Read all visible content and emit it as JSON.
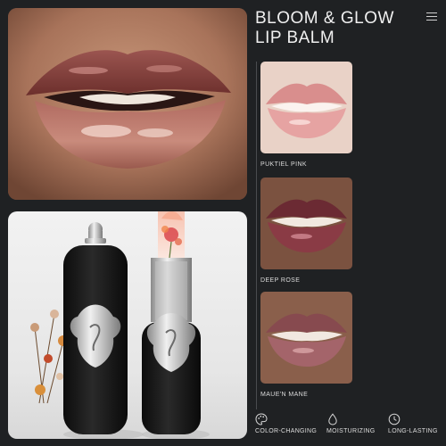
{
  "header": {
    "title_line1": "BLOOM & GLOW",
    "title_line2": "LIP BALM"
  },
  "colors": {
    "background": "#1f2123",
    "accent_text": "#f0f0f0",
    "product_body": "#141414",
    "ornament_silver": "#b8b8b8"
  },
  "icons": {
    "menu": "menu-icon",
    "feature_0": "palette-icon",
    "feature_1": "droplet-icon",
    "feature_2": "clock-icon"
  },
  "shades": [
    {
      "name": "PUKTIEL PINK",
      "color": "#e6a3a2"
    },
    {
      "name": "DEEP ROSE",
      "color": "#8a3b45"
    },
    {
      "name": "MAUE'N MANE",
      "color": "#a4646a"
    }
  ],
  "features": [
    {
      "label": "COLOR-CHANGING"
    },
    {
      "label": "MOISTURIZING"
    },
    {
      "label": "LONG-LASTING"
    }
  ]
}
